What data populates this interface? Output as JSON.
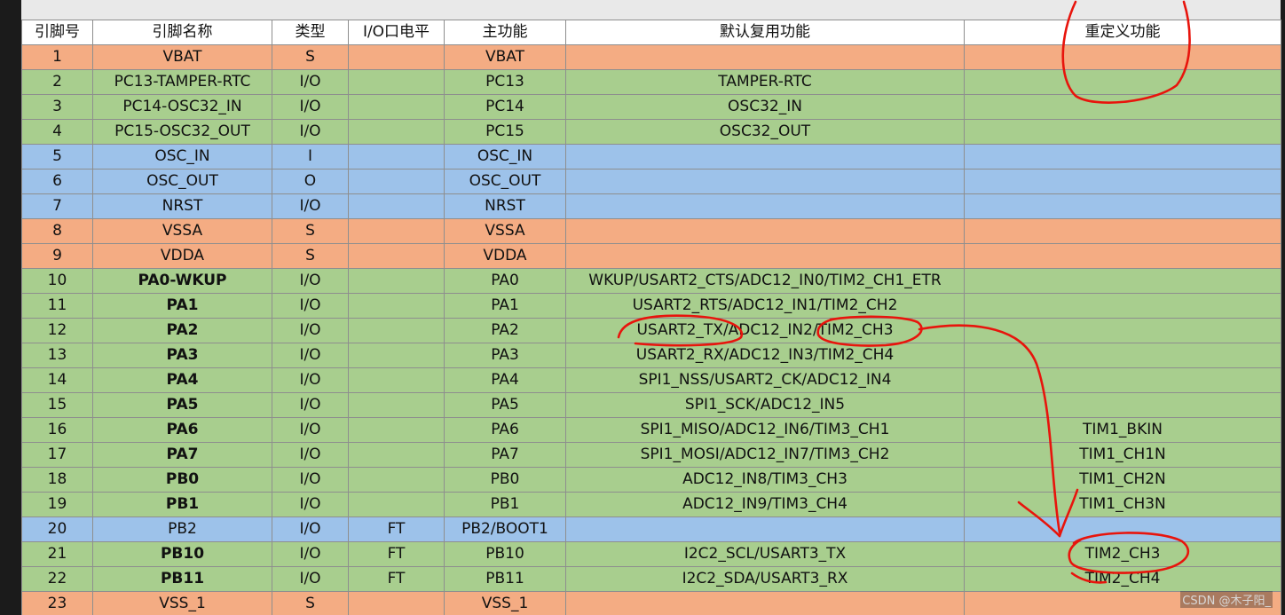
{
  "headers": [
    "引脚号",
    "引脚名称",
    "类型",
    "I/O口电平",
    "主功能",
    "默认复用功能",
    "重定义功能"
  ],
  "rows": [
    {
      "pin": "1",
      "name": "VBAT",
      "type": "S",
      "level": "",
      "main": "VBAT",
      "alt": "",
      "remap": "",
      "color": "orange",
      "bold": false
    },
    {
      "pin": "2",
      "name": "PC13-TAMPER-RTC",
      "type": "I/O",
      "level": "",
      "main": "PC13",
      "alt": "TAMPER-RTC",
      "remap": "",
      "color": "green",
      "bold": false
    },
    {
      "pin": "3",
      "name": "PC14-OSC32_IN",
      "type": "I/O",
      "level": "",
      "main": "PC14",
      "alt": "OSC32_IN",
      "remap": "",
      "color": "green",
      "bold": false
    },
    {
      "pin": "4",
      "name": "PC15-OSC32_OUT",
      "type": "I/O",
      "level": "",
      "main": "PC15",
      "alt": "OSC32_OUT",
      "remap": "",
      "color": "green",
      "bold": false
    },
    {
      "pin": "5",
      "name": "OSC_IN",
      "type": "I",
      "level": "",
      "main": "OSC_IN",
      "alt": "",
      "remap": "",
      "color": "blue",
      "bold": false
    },
    {
      "pin": "6",
      "name": "OSC_OUT",
      "type": "O",
      "level": "",
      "main": "OSC_OUT",
      "alt": "",
      "remap": "",
      "color": "blue",
      "bold": false
    },
    {
      "pin": "7",
      "name": "NRST",
      "type": "I/O",
      "level": "",
      "main": "NRST",
      "alt": "",
      "remap": "",
      "color": "blue",
      "bold": false
    },
    {
      "pin": "8",
      "name": "VSSA",
      "type": "S",
      "level": "",
      "main": "VSSA",
      "alt": "",
      "remap": "",
      "color": "orange",
      "bold": false
    },
    {
      "pin": "9",
      "name": "VDDA",
      "type": "S",
      "level": "",
      "main": "VDDA",
      "alt": "",
      "remap": "",
      "color": "orange",
      "bold": false
    },
    {
      "pin": "10",
      "name": "PA0-WKUP",
      "type": "I/O",
      "level": "",
      "main": "PA0",
      "alt": "WKUP/USART2_CTS/ADC12_IN0/TIM2_CH1_ETR",
      "remap": "",
      "color": "green",
      "bold": true
    },
    {
      "pin": "11",
      "name": "PA1",
      "type": "I/O",
      "level": "",
      "main": "PA1",
      "alt": "USART2_RTS/ADC12_IN1/TIM2_CH2",
      "remap": "",
      "color": "green",
      "bold": true
    },
    {
      "pin": "12",
      "name": "PA2",
      "type": "I/O",
      "level": "",
      "main": "PA2",
      "alt": "USART2_TX/ADC12_IN2/TIM2_CH3",
      "remap": "",
      "color": "green",
      "bold": true
    },
    {
      "pin": "13",
      "name": "PA3",
      "type": "I/O",
      "level": "",
      "main": "PA3",
      "alt": "USART2_RX/ADC12_IN3/TIM2_CH4",
      "remap": "",
      "color": "green",
      "bold": true
    },
    {
      "pin": "14",
      "name": "PA4",
      "type": "I/O",
      "level": "",
      "main": "PA4",
      "alt": "SPI1_NSS/USART2_CK/ADC12_IN4",
      "remap": "",
      "color": "green",
      "bold": true
    },
    {
      "pin": "15",
      "name": "PA5",
      "type": "I/O",
      "level": "",
      "main": "PA5",
      "alt": "SPI1_SCK/ADC12_IN5",
      "remap": "",
      "color": "green",
      "bold": true
    },
    {
      "pin": "16",
      "name": "PA6",
      "type": "I/O",
      "level": "",
      "main": "PA6",
      "alt": "SPI1_MISO/ADC12_IN6/TIM3_CH1",
      "remap": "TIM1_BKIN",
      "color": "green",
      "bold": true
    },
    {
      "pin": "17",
      "name": "PA7",
      "type": "I/O",
      "level": "",
      "main": "PA7",
      "alt": "SPI1_MOSI/ADC12_IN7/TIM3_CH2",
      "remap": "TIM1_CH1N",
      "color": "green",
      "bold": true
    },
    {
      "pin": "18",
      "name": "PB0",
      "type": "I/O",
      "level": "",
      "main": "PB0",
      "alt": "ADC12_IN8/TIM3_CH3",
      "remap": "TIM1_CH2N",
      "color": "green",
      "bold": true
    },
    {
      "pin": "19",
      "name": "PB1",
      "type": "I/O",
      "level": "",
      "main": "PB1",
      "alt": "ADC12_IN9/TIM3_CH4",
      "remap": "TIM1_CH3N",
      "color": "green",
      "bold": true
    },
    {
      "pin": "20",
      "name": "PB2",
      "type": "I/O",
      "level": "FT",
      "main": "PB2/BOOT1",
      "alt": "",
      "remap": "",
      "color": "blue",
      "bold": false
    },
    {
      "pin": "21",
      "name": "PB10",
      "type": "I/O",
      "level": "FT",
      "main": "PB10",
      "alt": "I2C2_SCL/USART3_TX",
      "remap": "TIM2_CH3",
      "color": "green",
      "bold": true
    },
    {
      "pin": "22",
      "name": "PB11",
      "type": "I/O",
      "level": "FT",
      "main": "PB11",
      "alt": "I2C2_SDA/USART3_RX",
      "remap": "TIM2_CH4",
      "color": "green",
      "bold": true
    },
    {
      "pin": "23",
      "name": "VSS_1",
      "type": "S",
      "level": "",
      "main": "VSS_1",
      "alt": "",
      "remap": "",
      "color": "orange",
      "bold": false
    }
  ],
  "watermark": "CSDN @木子阳_",
  "colors": {
    "orange_row": "#f4ac83",
    "green_row": "#a8ce8e",
    "blue_row": "#9dc2ea",
    "annotation": "#e8140c"
  }
}
